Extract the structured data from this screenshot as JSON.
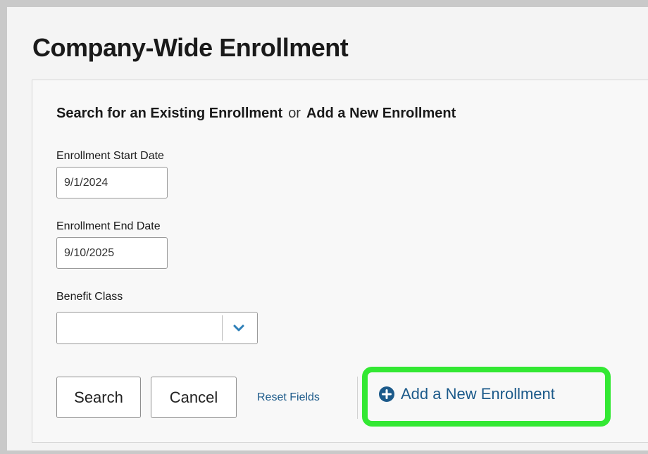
{
  "page": {
    "title": "Company-Wide Enrollment"
  },
  "search_panel": {
    "heading_search": "Search for an Existing Enrollment",
    "heading_or": "or",
    "heading_add": "Add a New Enrollment",
    "start_date": {
      "label": "Enrollment Start Date",
      "value": "9/1/2024"
    },
    "end_date": {
      "label": "Enrollment End Date",
      "value": "9/10/2025"
    },
    "benefit_class": {
      "label": "Benefit Class",
      "value": ""
    }
  },
  "actions": {
    "search_label": "Search",
    "cancel_label": "Cancel",
    "reset_label": "Reset Fields",
    "add_label": "Add a New Enrollment"
  },
  "colors": {
    "link": "#1c5a8a",
    "highlight": "#33e833",
    "chevron": "#2e7fb8"
  },
  "icons": {
    "select_toggle": "chevron-down-icon",
    "add": "plus-circle-icon"
  }
}
